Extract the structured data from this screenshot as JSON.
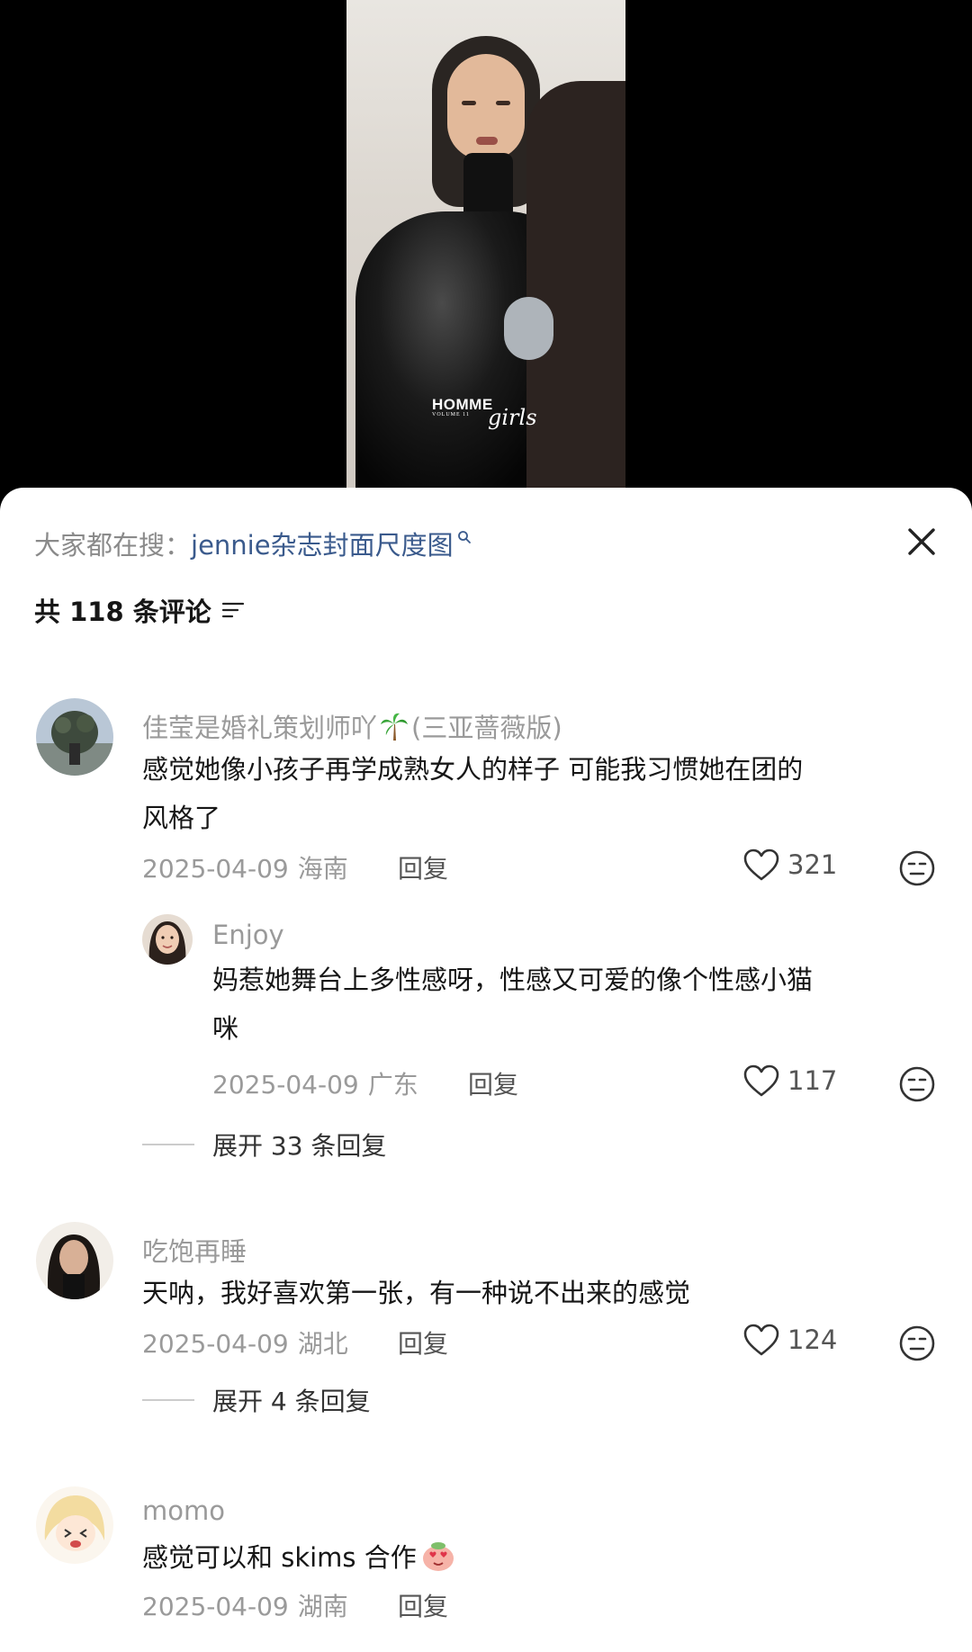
{
  "video": {
    "watermark_brand": "HOMME",
    "watermark_volume": "VOLUME 11",
    "watermark_script": "girls"
  },
  "search": {
    "prefix": "大家都在搜：",
    "query": "jennie杂志封面尺度图"
  },
  "comments_header": {
    "count_text": "共 118 条评论"
  },
  "comments": [
    {
      "author": "佳莹是婚礼策划师吖",
      "author_suffix": "(三亚蔷薇版)",
      "text_line1": "感觉她像小孩子再学成熟女人的样子 可能我习惯她在团的",
      "text_line2": "风格了",
      "date": "2025-04-09",
      "location": "海南",
      "reply_label": "回复",
      "likes": "321",
      "replies": [
        {
          "author": "Enjoy",
          "text_line1": "妈惹她舞台上多性感呀，性感又可爱的像个性感小猫",
          "text_line2": "咪",
          "date": "2025-04-09",
          "location": "广东",
          "reply_label": "回复",
          "likes": "117"
        }
      ],
      "expand_label": "展开 33 条回复"
    },
    {
      "author": "吃饱再睡",
      "text_line1": "天呐，我好喜欢第一张，有一种说不出来的感觉",
      "date": "2025-04-09",
      "location": "湖北",
      "reply_label": "回复",
      "likes": "124",
      "expand_label": "展开 4 条回复"
    },
    {
      "author": "momo",
      "text_line1": "感觉可以和 skims 合作",
      "date": "2025-04-09",
      "location": "湖南",
      "reply_label": "回复"
    }
  ],
  "icons": {
    "close": "close-icon",
    "search": "search-icon",
    "filter": "filter-icon",
    "like": "heart-outline-icon",
    "react": "meh-face-icon",
    "palm": "palm-tree-icon",
    "heart_eyes": "heart-eyes-emoji-icon"
  },
  "colors": {
    "link": "#3a5a8c",
    "secondary_text": "#9a9a9a",
    "primary_text": "#161616"
  }
}
